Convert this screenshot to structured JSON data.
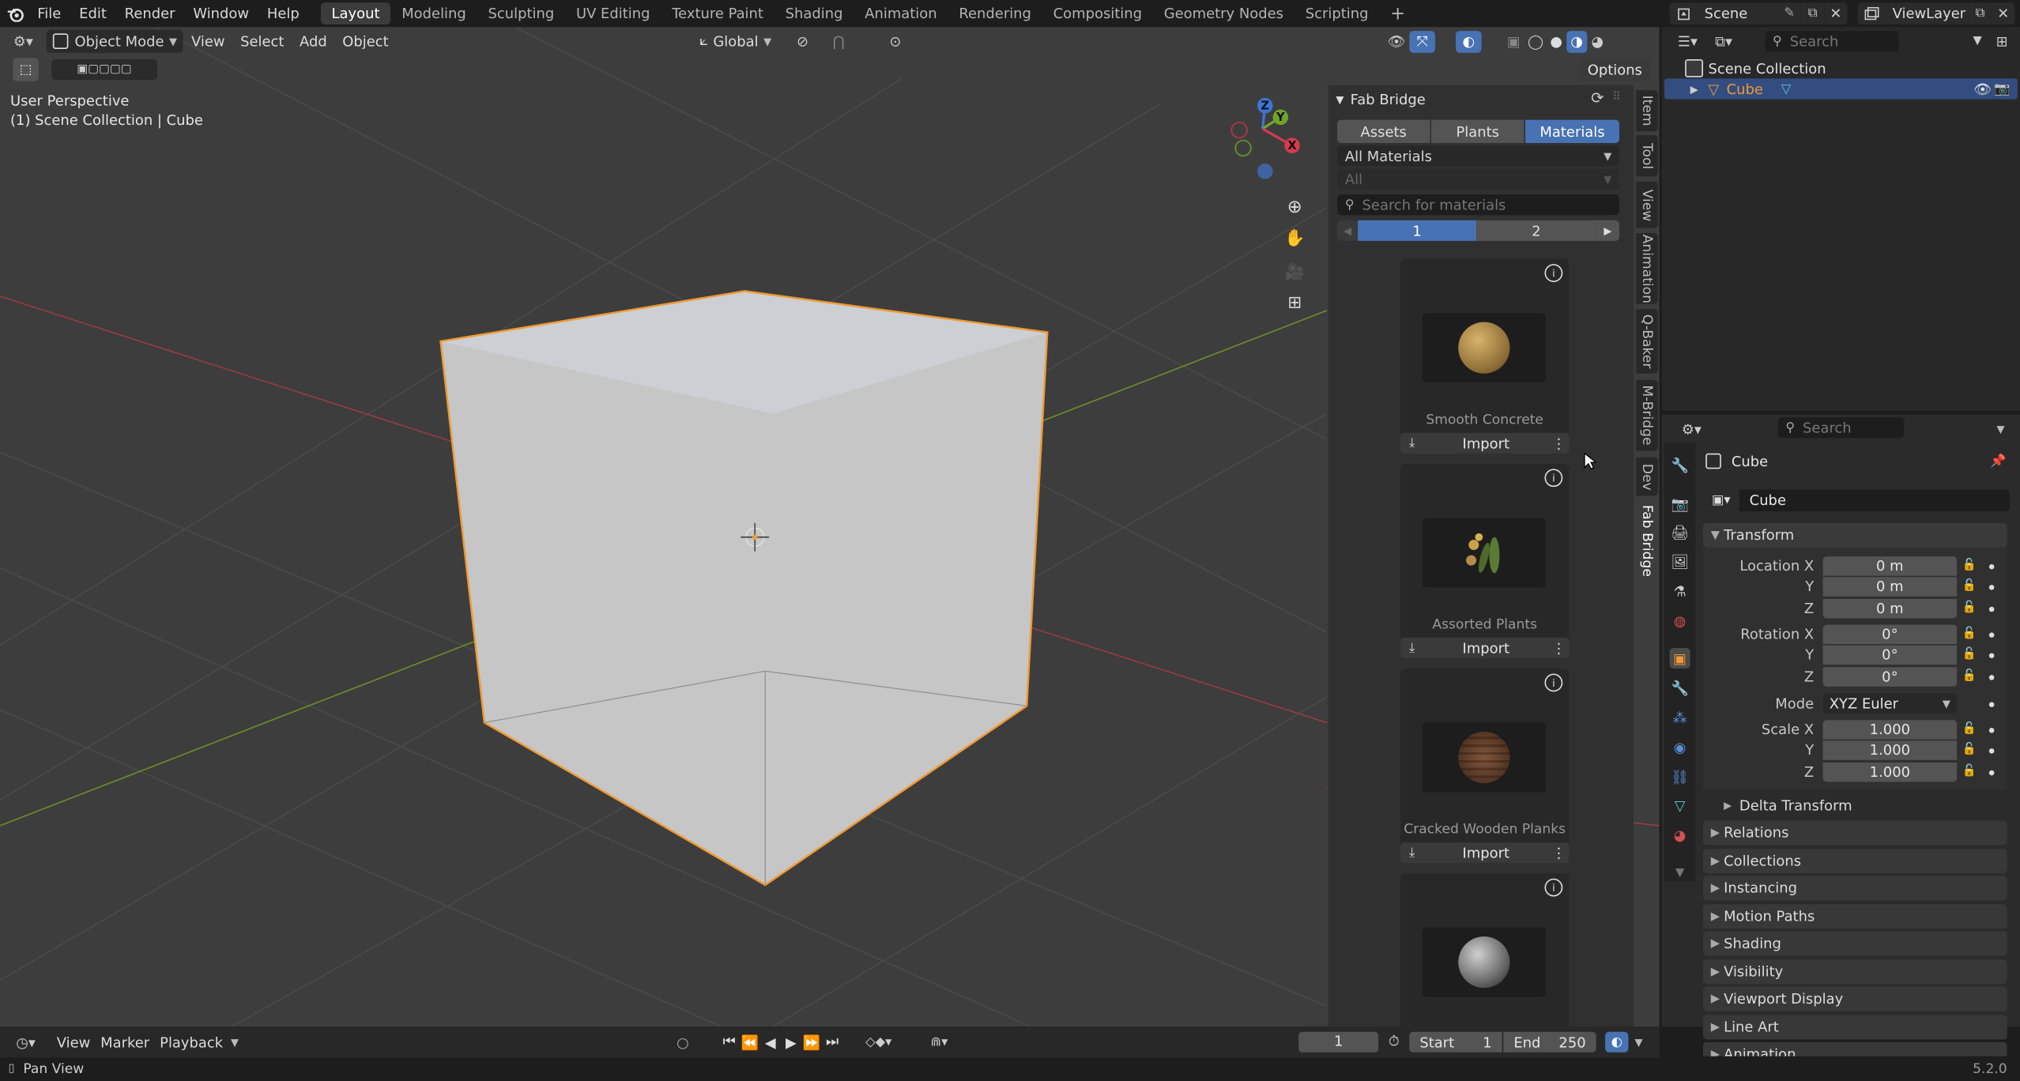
{
  "topbar": {
    "menus": [
      "File",
      "Edit",
      "Render",
      "Window",
      "Help"
    ],
    "workspaces": [
      "Layout",
      "Modeling",
      "Sculpting",
      "UV Editing",
      "Texture Paint",
      "Shading",
      "Animation",
      "Rendering",
      "Compositing",
      "Geometry Nodes",
      "Scripting"
    ],
    "active_workspace": "Layout",
    "add_workspace": "+",
    "scene": "Scene",
    "view_layer": "ViewLayer"
  },
  "viewport_header": {
    "mode": "Object Mode",
    "menus": [
      "View",
      "Select",
      "Add",
      "Object"
    ],
    "orientation": "Global",
    "options": "Options"
  },
  "viewport": {
    "perspective": "User Perspective",
    "collection_path": "(1) Scene Collection | Cube",
    "gizmo": {
      "z": "Z",
      "y": "Y",
      "x": "X"
    }
  },
  "fab": {
    "title": "Fab Bridge",
    "tabs": [
      "Assets",
      "Plants",
      "Materials"
    ],
    "active_tab": "Materials",
    "category": "All Materials",
    "subcategory": "All",
    "search_placeholder": "Search for materials",
    "pages": [
      "1",
      "2"
    ],
    "active_page": "1",
    "import_label": "Import",
    "cards": [
      {
        "name": "Smooth Concrete",
        "swatch": "#b08a4a"
      },
      {
        "name": "Assorted Plants",
        "swatch": "#8aa05a"
      },
      {
        "name": "Cracked Wooden Planks",
        "swatch": "#a08066"
      },
      {
        "name": "",
        "swatch": "#8a8a8a"
      }
    ]
  },
  "side_tabs": [
    "Item",
    "Tool",
    "View",
    "Animation",
    "Q-Baker",
    "M-Bridge",
    "Dev",
    "Fab Bridge"
  ],
  "active_side_tab": "Fab Bridge",
  "outliner": {
    "search_placeholder": "Search",
    "root": "Scene Collection",
    "items": [
      {
        "name": "Cube"
      }
    ]
  },
  "properties": {
    "search_placeholder": "Search",
    "object_name": "Cube",
    "datablock": "Cube",
    "transform_label": "Transform",
    "location": {
      "label": "Location X",
      "x": "0 m",
      "y": "0 m",
      "z": "0 m"
    },
    "rotation": {
      "label": "Rotation X",
      "x": "0°",
      "y": "0°",
      "z": "0°"
    },
    "axis_y": "Y",
    "axis_z": "Z",
    "mode_label": "Mode",
    "mode_value": "XYZ Euler",
    "scale": {
      "label": "Scale X",
      "x": "1.000",
      "y": "1.000",
      "z": "1.000"
    },
    "delta_transform": "Delta Transform",
    "panels": [
      "Relations",
      "Collections",
      "Instancing",
      "Motion Paths",
      "Shading",
      "Visibility",
      "Viewport Display",
      "Line Art",
      "Animation"
    ]
  },
  "timeline": {
    "menus": [
      "View",
      "Marker",
      "Playback"
    ],
    "current_frame": "1",
    "start_label": "Start",
    "start": "1",
    "end_label": "End",
    "end": "250"
  },
  "status": {
    "hint": "Pan View",
    "version": "5.2.0"
  },
  "colors": {
    "accent": "#4772b3",
    "selection": "#ffa033",
    "header_bg": "#303030"
  }
}
